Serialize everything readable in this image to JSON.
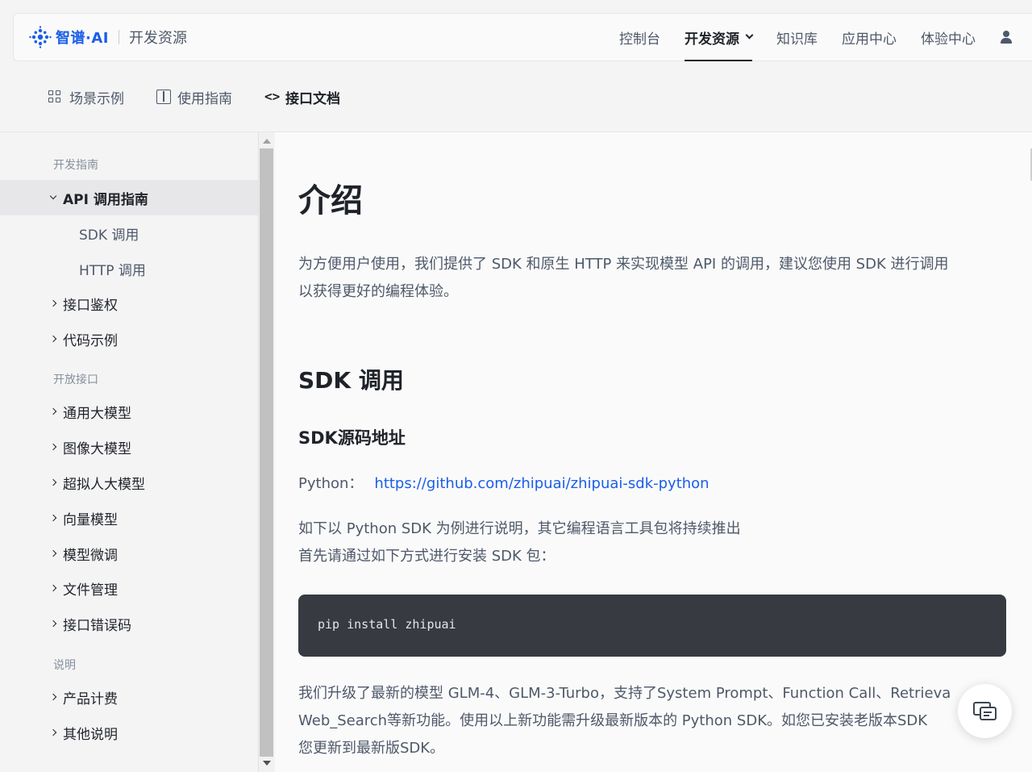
{
  "header": {
    "brand_name": "智谱·AI",
    "brand_sub": "开发资源",
    "nav": [
      "控制台",
      "开发资源",
      "知识库",
      "应用中心",
      "体验中心"
    ],
    "active_nav": "开发资源",
    "user_icon": "user-icon"
  },
  "subnav": {
    "items": [
      {
        "label": "场景示例",
        "icon": "grid-icon"
      },
      {
        "label": "使用指南",
        "icon": "book-icon"
      },
      {
        "label": "接口文档",
        "icon": "code-icon"
      }
    ],
    "active": "接口文档"
  },
  "sidebar": {
    "group1": "开发指南",
    "api_guide": "API 调用指南",
    "sdk_call": "SDK 调用",
    "http_call": "HTTP 调用",
    "auth": "接口鉴权",
    "code_examples": "代码示例",
    "group2": "开放接口",
    "general_model": "通用大模型",
    "image_model": "图像大模型",
    "character_model": "超拟人大模型",
    "vector_model": "向量模型",
    "fine_tune": "模型微调",
    "file_mgmt": "文件管理",
    "error_codes": "接口错误码",
    "group3": "说明",
    "billing": "产品计费",
    "other": "其他说明"
  },
  "content": {
    "title": "介绍",
    "intro_line1": "为方便用户使用，我们提供了 SDK 和原生 HTTP 来实现模型 API 的调用，建议您使用 SDK 进行调用",
    "intro_line2": "以获得更好的编程体验。",
    "sdk_heading": "SDK 调用",
    "sdk_source_heading": "SDK源码地址",
    "python_label": "Python：",
    "python_link": "https://github.com/zhipuai/zhipuai-sdk-python",
    "python_note_line1": "如下以 Python SDK 为例进行说明，其它编程语言工具包将持续推出",
    "python_note_line2": "首先请通过如下方式进行安装 SDK 包：",
    "code": "pip install zhipuai",
    "upgrade_line1": "我们升级了最新的模型 GLM-4、GLM-3-Turbo，支持了System Prompt、Function Call、Retrieva",
    "upgrade_line2": "Web_Search等新功能。使用以上新功能需升级最新版本的 Python SDK。如您已安装老版本SDK",
    "upgrade_line3": "您更新到最新版SDK。"
  },
  "fab_icon": "chat-icon",
  "colors": {
    "brand": "#1a5eea",
    "link": "#1a5eea",
    "code_bg": "#383a42"
  }
}
